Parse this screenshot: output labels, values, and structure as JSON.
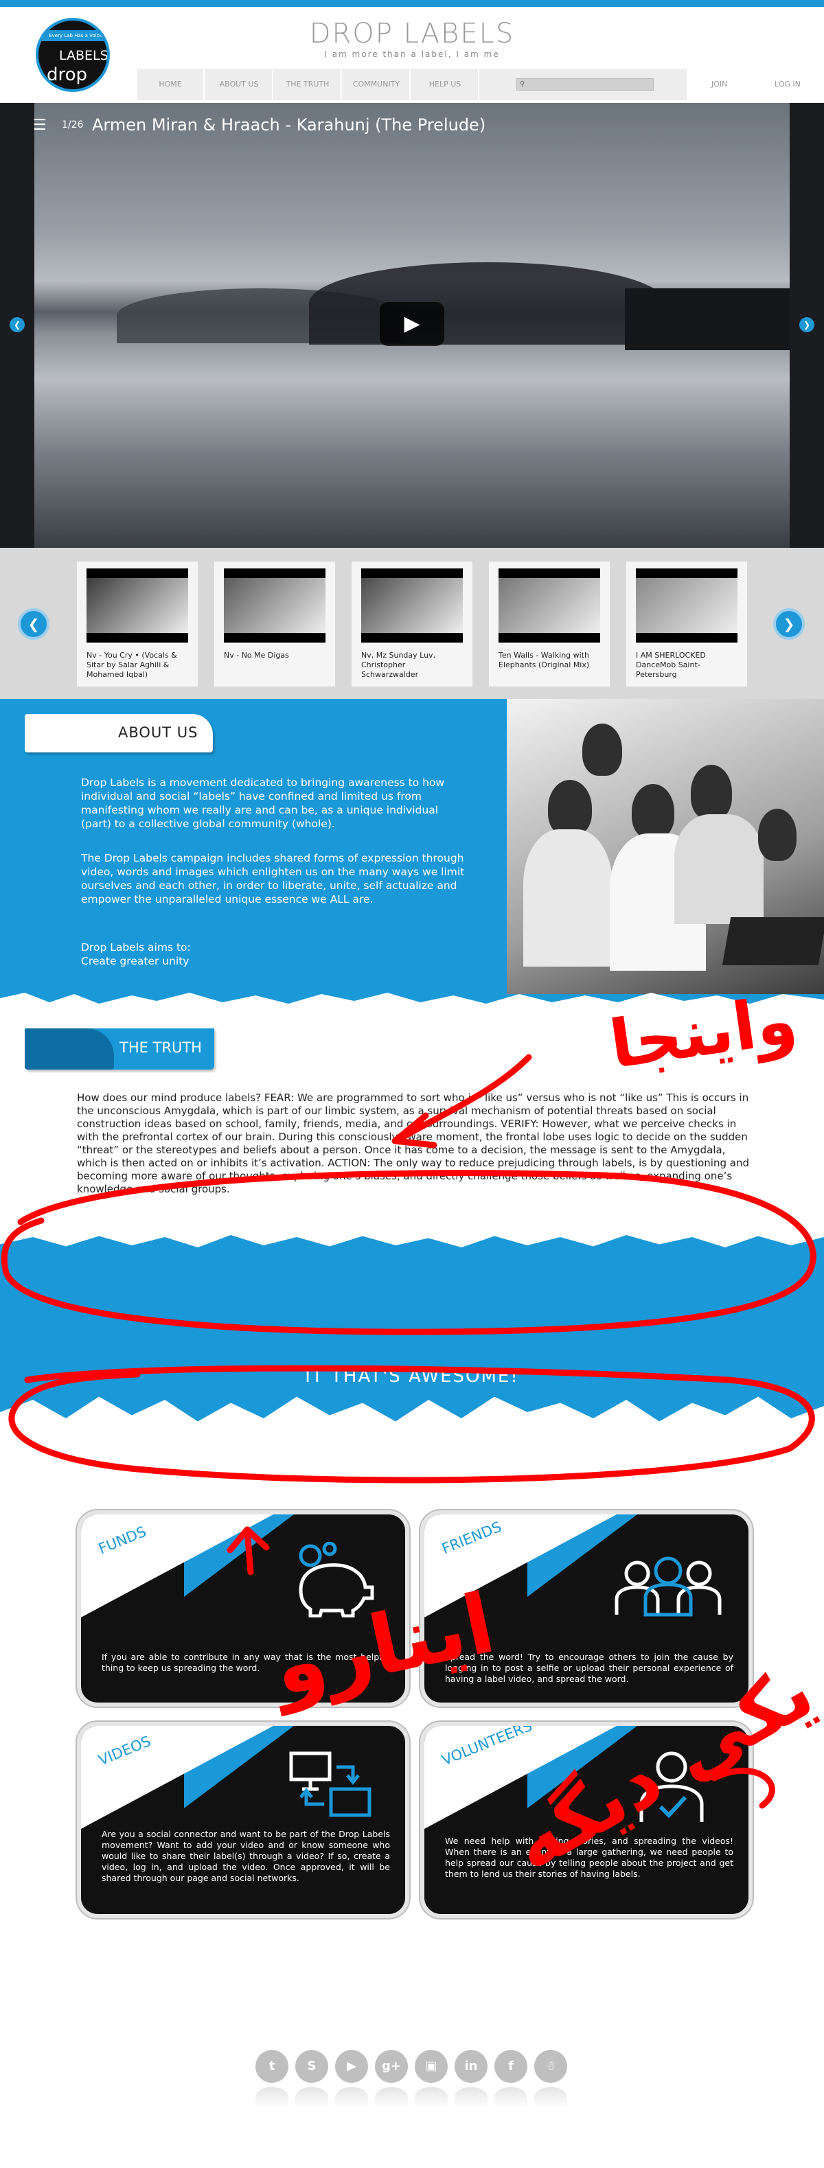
{
  "header": {
    "logo_band": "Every Lab Has a Voice",
    "logo_word1": "LABELS",
    "logo_word2": "drop",
    "site_title": "DROP LABELS",
    "tagline": "I am more than a label, I am me",
    "nav": [
      "HOME",
      "ABOUT US",
      "THE TRUTH",
      "COMMUNITY",
      "HELP US"
    ],
    "search_placeholder": "",
    "join": "JOIN",
    "login": "LOG IN"
  },
  "video": {
    "playlist_icon": "playlist-icon",
    "counter": "1/26",
    "title": "Armen Miran & Hraach - Karahunj (The Prelude)",
    "play_icon": "play-icon"
  },
  "carousel": {
    "items": [
      {
        "caption": "Nv - You Cry • (Vocals & Sitar by Salar Aghili & Mohamed Iqbal)",
        "tone": "#3a3a3a"
      },
      {
        "caption": "Nv - No Me Digas",
        "tone": "#5a5a5a"
      },
      {
        "caption": "Nv, Mz Sunday Luv, Christopher Schwarzwalder",
        "tone": "#4a4a4a"
      },
      {
        "caption": "Ten Walls - Walking with Elephants (Original Mix)",
        "tone": "#777777"
      },
      {
        "caption": "I AM SHERLOCKED DanceMob Saint-Petersburg",
        "tone": "#8a8a8a"
      }
    ]
  },
  "about": {
    "heading": "ABOUT US",
    "p1": "Drop Labels is a movement dedicated to bringing awareness to how individual and social “labels” have confined and limited us from manifesting whom we really are and can be, as a unique individual (part) to a collective global community (whole).",
    "p2": "The Drop Labels campaign includes shared forms of expression through video, words and images which enlighten us on the many ways we limit ourselves and each other, in order to liberate, unite, self actualize and empower the unparalleled unique essence we ALL are.",
    "p3": "Drop Labels aims to:",
    "p4": "Create greater unity"
  },
  "truth": {
    "heading": "THE TRUTH",
    "body": "How does our mind produce labels? FEAR: We are programmed to sort who is “like us” versus who is not “like us” This is occurs in the unconscious Amygdala, which is part of our limbic system, as a survival mechanism of potential threats based on social construction ideas based on school, family, friends, media, and our surroundings. VERIFY: However, what we perceive checks in with the prefrontal cortex of our brain. During this consciously aware moment, the frontal lobe uses logic to decide on the sudden “threat” or the stereotypes and beliefs about a person. Once it has come to a decision, the message is sent to the Amygdala, which is then acted on or inhibits it’s activation. ACTION: The only way to reduce prejudicing through labels, is by questioning and becoming more aware of our thoughts, exploring one’s biases, and directly challenge those beliefs as well as, expanding one’s knowledge and social groups."
  },
  "band": {
    "text": "IT THAT'S AWESOME!"
  },
  "cards": [
    {
      "title": "FUNDS",
      "icon": "piggy-bank-icon",
      "body": "If you are able to contribute in any way that is the most helpful thing to keep us spreading the word."
    },
    {
      "title": "FRIENDS",
      "icon": "people-group-icon",
      "body": "Spread the word! Try to encourage others to join the cause by logging in to post a selfie or upload their personal experience of having a label video, and spread the word."
    },
    {
      "title": "VIDEOS",
      "icon": "video-share-icon",
      "body": "Are you a social connector and want to be part of the Drop Labels movement? Want to add your video and or know someone who would like to share their label(s) through a video? If so, create a video, log in, and upload the video. Once approved, it will be shared through our page and social networks."
    },
    {
      "title": "VOLUNTEERS",
      "icon": "volunteer-icon",
      "body": "We need help with filming stories, and spreading the videos! When there is an event or a large gathering, we need people to help spread our cause by telling people about the project and get them to lend us their stories of having labels."
    }
  ],
  "social": [
    {
      "name": "twitter-icon",
      "glyph": "t"
    },
    {
      "name": "skype-icon",
      "glyph": "S"
    },
    {
      "name": "youtube-icon",
      "glyph": "▶"
    },
    {
      "name": "google-plus-icon",
      "glyph": "g+"
    },
    {
      "name": "instagram-icon",
      "glyph": "▣"
    },
    {
      "name": "linkedin-icon",
      "glyph": "in"
    },
    {
      "name": "facebook-icon",
      "glyph": "f"
    },
    {
      "name": "snapchat-icon",
      "glyph": "☃"
    }
  ],
  "annotations": {
    "text_top": "واینجا",
    "text_mid": "اینارو",
    "text_right": "یکی دیگه",
    "color": "#ff0000"
  },
  "colors": {
    "accent": "#1b98d7",
    "annotation": "#ff0000"
  }
}
